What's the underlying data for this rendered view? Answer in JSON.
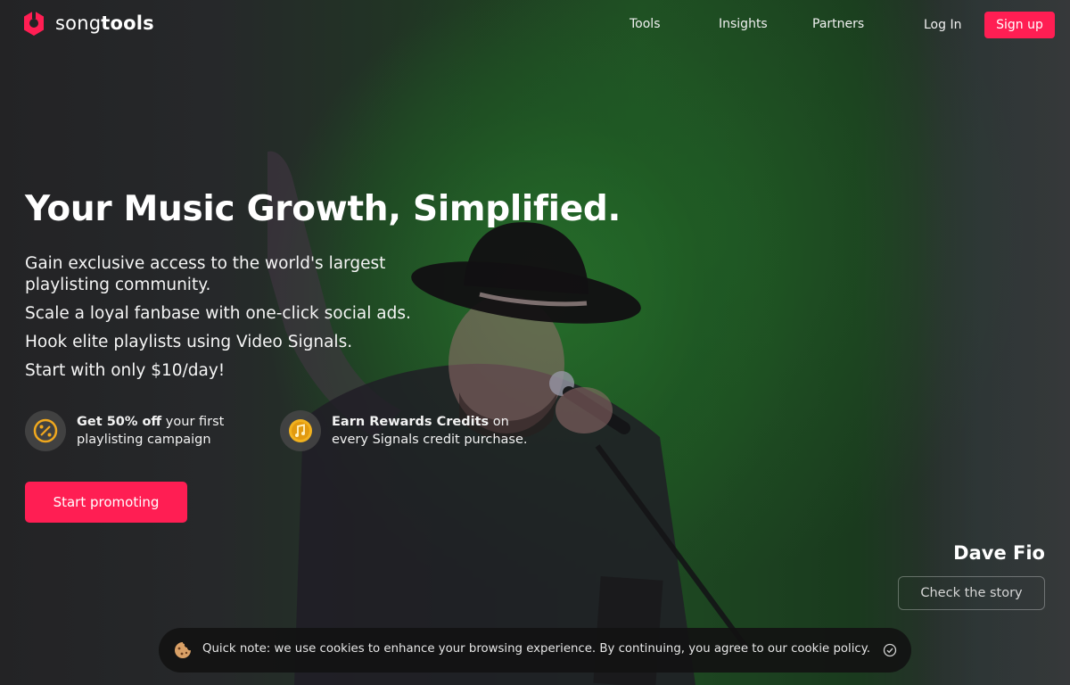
{
  "brand": {
    "name_light": "song",
    "name_bold": "tools",
    "accent": "#ff1e53"
  },
  "nav": {
    "links": [
      "Tools",
      "Insights",
      "Partners"
    ],
    "login": "Log In",
    "signup": "Sign up"
  },
  "hero": {
    "title": "Your Music Growth, Simplified.",
    "lines": [
      "Gain exclusive access to the world's largest playlisting community.",
      "Scale a loyal fanbase with one-click social ads.",
      "Hook elite playlists using Video Signals.",
      "Start with only $10/day!"
    ],
    "perks": [
      {
        "icon": "percent-icon",
        "bold": "Get 50% off",
        "text": " your first playlisting campaign"
      },
      {
        "icon": "music-coin-icon",
        "bold": "Earn Rewards Credits",
        "text": " on every Signals credit purchase."
      }
    ],
    "cta": "Start promoting"
  },
  "story": {
    "name": "Dave Fio",
    "button": "Check the story"
  },
  "cookie": {
    "text": "Quick note: we use cookies to enhance your browsing experience. By continuing, you agree to our cookie policy."
  }
}
